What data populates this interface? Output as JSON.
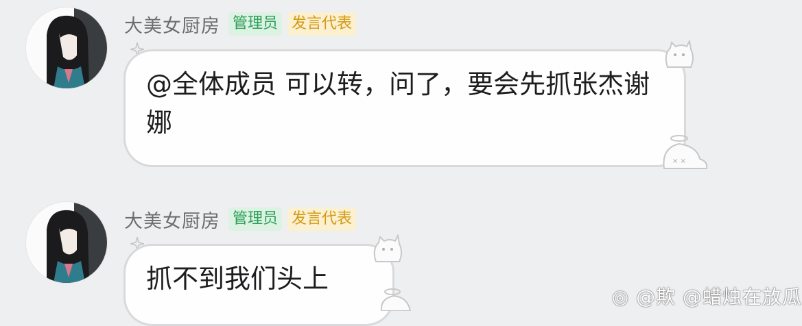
{
  "messages": [
    {
      "sender": "大美女厨房",
      "badges": [
        "管理员",
        "发言代表"
      ],
      "text": "@全体成员 可以转，问了，要会先抓张杰谢娜"
    },
    {
      "sender": "大美女厨房",
      "badges": [
        "管理员",
        "发言代表"
      ],
      "text": "抓不到我们头上"
    }
  ],
  "watermark": "@欺 @蜡烛在放瓜",
  "colors": {
    "background": "#eeeff1",
    "admin_badge_bg": "#dcf2e3",
    "admin_badge_text": "#2e9e5a",
    "rep_badge_bg": "#fbf0cf",
    "rep_badge_text": "#d49a17"
  }
}
